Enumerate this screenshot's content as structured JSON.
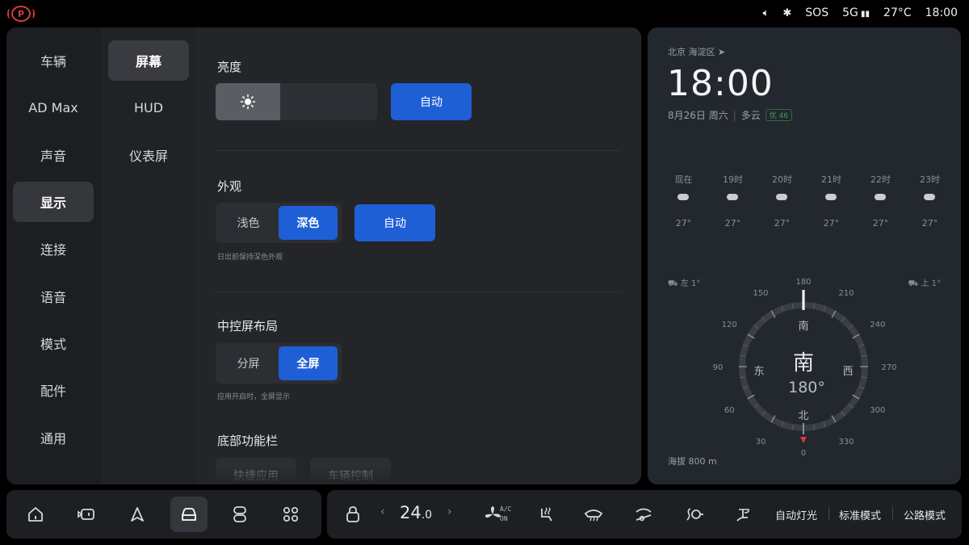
{
  "status": {
    "time": "18:00",
    "temp": "27°C",
    "network": "5G",
    "sos": "SOS",
    "park_icon": "park-brake-icon",
    "park_letter": "P"
  },
  "nav_primary": [
    {
      "label": "车辆"
    },
    {
      "label": "AD Max"
    },
    {
      "label": "声音"
    },
    {
      "label": "显示",
      "active": true
    },
    {
      "label": "连接"
    },
    {
      "label": "语音"
    },
    {
      "label": "模式"
    },
    {
      "label": "配件"
    },
    {
      "label": "通用"
    }
  ],
  "nav_secondary": [
    {
      "label": "屏幕",
      "active": true
    },
    {
      "label": "HUD"
    },
    {
      "label": "仪表屏"
    }
  ],
  "content": {
    "brightness": {
      "title": "亮度",
      "level": 0.4,
      "auto_label": "自动"
    },
    "appearance": {
      "title": "外观",
      "options": [
        "浅色",
        "深色"
      ],
      "selected": "深色",
      "auto_label": "自动",
      "hint": "日出前保持深色外观"
    },
    "layout": {
      "title": "中控屏布局",
      "options": [
        "分屏",
        "全屏"
      ],
      "selected": "全屏",
      "hint": "应用开启时，全屏显示"
    },
    "bottom_bar": {
      "title": "底部功能栏",
      "options": [
        "快捷应用",
        "车辆控制"
      ]
    }
  },
  "weather": {
    "location": "北京 海淀区",
    "time": "18:00",
    "date": "8月26日 周六",
    "condition": "多云",
    "aqi": "优 46",
    "hourly": [
      {
        "label": "现在",
        "temp": "27°"
      },
      {
        "label": "19时",
        "temp": "27°"
      },
      {
        "label": "20时",
        "temp": "27°"
      },
      {
        "label": "21时",
        "temp": "27°"
      },
      {
        "label": "22时",
        "temp": "27°"
      },
      {
        "label": "23时",
        "temp": "27°"
      }
    ],
    "incline_left": "左 1°",
    "incline_right": "上 1°",
    "compass": {
      "heading": "南",
      "degrees": "180°",
      "top_label": "南",
      "bottom_label": "北",
      "left_label": "东",
      "right_label": "西",
      "ticks": [
        "180",
        "210",
        "240",
        "270",
        "300",
        "330",
        "0",
        "30",
        "60",
        "90",
        "120",
        "150"
      ]
    },
    "altitude_label": "海拔",
    "altitude_value": "800 m"
  },
  "dock": {
    "left_icons": [
      "home-icon",
      "mirror-icon",
      "navigation-icon",
      "car-icon",
      "vehicle-control-icon",
      "apps-icon"
    ],
    "active_left": "car-icon",
    "temperature_int": "24",
    "temperature_dec": ".0",
    "ac_label_1": "A/C",
    "ac_label_2": "ON",
    "right_icons": [
      "lock-icon",
      "fan-icon",
      "seat-heat-icon",
      "front-defrost-icon",
      "wiper-icon",
      "steering-heat-icon",
      "seat-ventilation-icon"
    ],
    "modes": [
      "自动灯光",
      "标准模式",
      "公路模式"
    ]
  }
}
